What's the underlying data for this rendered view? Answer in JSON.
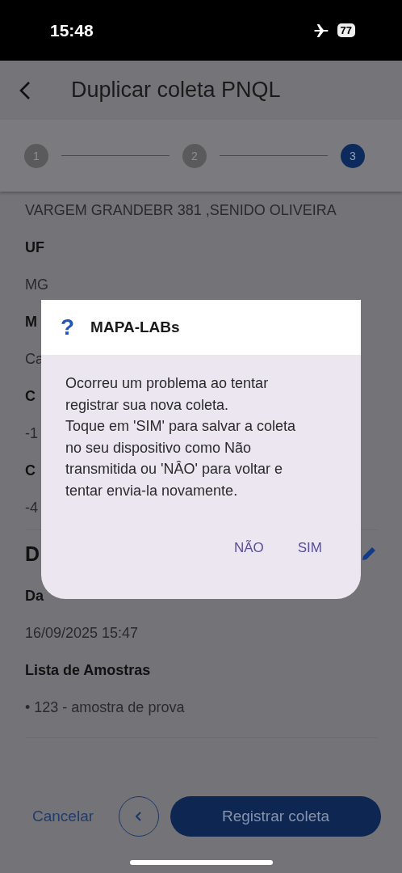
{
  "status_bar": {
    "time": "15:48",
    "battery": "77"
  },
  "header": {
    "title": "Duplicar coleta PNQL"
  },
  "stepper": [
    {
      "label": "1",
      "selected": false
    },
    {
      "label": "2",
      "selected": false
    },
    {
      "label": "3",
      "selected": true
    }
  ],
  "details": [
    {
      "kind": "value",
      "text": "VARGEM GRANDEBR 381 ,SENIDO OLIVEIRA"
    },
    {
      "kind": "label",
      "text": "UF"
    },
    {
      "kind": "value",
      "text": "MG"
    },
    {
      "kind": "label",
      "text": "M"
    },
    {
      "kind": "value",
      "text": "Ca"
    },
    {
      "kind": "label",
      "text": "C"
    },
    {
      "kind": "value",
      "text": "-1"
    },
    {
      "kind": "label",
      "text": "C"
    },
    {
      "kind": "value",
      "text": "-4"
    },
    {
      "kind": "heading",
      "text": "D"
    },
    {
      "kind": "label",
      "text": "Da"
    },
    {
      "kind": "value",
      "text": "16/09/2025 15:47"
    },
    {
      "kind": "label",
      "text": "Lista de Amostras"
    },
    {
      "kind": "value",
      "text": "• 123 - amostra de prova"
    }
  ],
  "footer": {
    "cancel": "Cancelar",
    "primary": "Registrar coleta"
  },
  "dialog": {
    "icon": "?",
    "title": "MAPA-LABs",
    "message": "Ocorreu um problema ao tentar registrar sua nova coleta.\nToque em 'SIM' para salvar a coleta no seu dispositivo como Não transmitida ou 'NÂO' para voltar e tentar envia-la novamente.",
    "buttons": [
      "NÃO",
      "SIM"
    ]
  }
}
